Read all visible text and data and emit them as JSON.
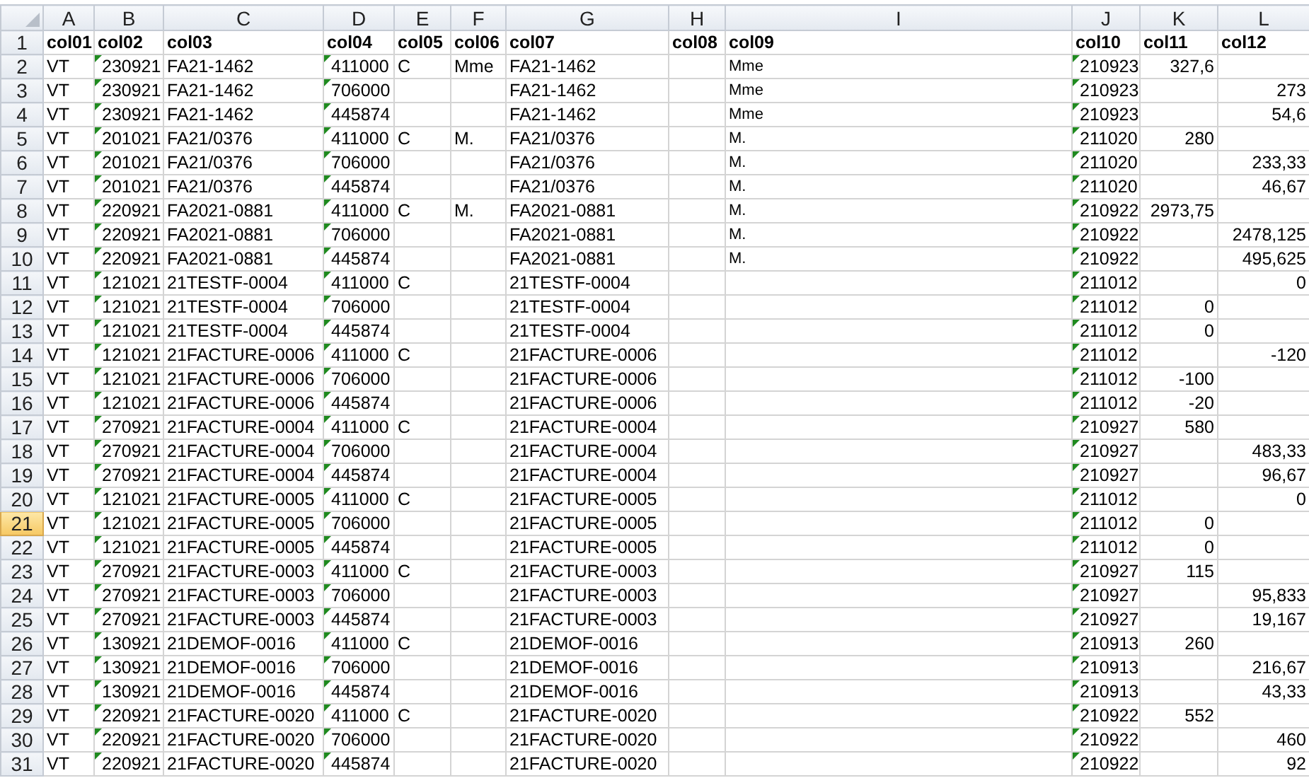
{
  "columns": [
    {
      "letter": "A",
      "kind": "text"
    },
    {
      "letter": "B",
      "kind": "flagged"
    },
    {
      "letter": "C",
      "kind": "text"
    },
    {
      "letter": "D",
      "kind": "flagged"
    },
    {
      "letter": "E",
      "kind": "text"
    },
    {
      "letter": "F",
      "kind": "text"
    },
    {
      "letter": "G",
      "kind": "text"
    },
    {
      "letter": "H",
      "kind": "text"
    },
    {
      "letter": "I",
      "kind": "small"
    },
    {
      "letter": "J",
      "kind": "flagged"
    },
    {
      "letter": "K",
      "kind": "number"
    },
    {
      "letter": "L",
      "kind": "number"
    }
  ],
  "header_row": {
    "number": "1",
    "selected": false,
    "cells": [
      "col01",
      "col02",
      "col03",
      "col04",
      "col05",
      "col06",
      "col07",
      "col08",
      "col09",
      "col10",
      "col11",
      "col12"
    ]
  },
  "rows": [
    {
      "number": "2",
      "selected": false,
      "cells": [
        "VT",
        "230921",
        "FA21-1462",
        "411000",
        "C",
        "Mme",
        "FA21-1462",
        null,
        "Mme",
        "210923",
        "327,6",
        null
      ]
    },
    {
      "number": "3",
      "selected": false,
      "cells": [
        "VT",
        "230921",
        "FA21-1462",
        "706000",
        null,
        null,
        "FA21-1462",
        null,
        "Mme",
        "210923",
        null,
        "273"
      ]
    },
    {
      "number": "4",
      "selected": false,
      "cells": [
        "VT",
        "230921",
        "FA21-1462",
        "445874",
        null,
        null,
        "FA21-1462",
        null,
        "Mme",
        "210923",
        null,
        "54,6"
      ]
    },
    {
      "number": "5",
      "selected": false,
      "cells": [
        "VT",
        "201021",
        "FA21/0376",
        "411000",
        "C",
        "M.",
        "FA21/0376",
        null,
        "M.",
        "211020",
        "280",
        null
      ]
    },
    {
      "number": "6",
      "selected": false,
      "cells": [
        "VT",
        "201021",
        "FA21/0376",
        "706000",
        null,
        null,
        "FA21/0376",
        null,
        "M.",
        "211020",
        null,
        "233,33"
      ]
    },
    {
      "number": "7",
      "selected": false,
      "cells": [
        "VT",
        "201021",
        "FA21/0376",
        "445874",
        null,
        null,
        "FA21/0376",
        null,
        "M.",
        "211020",
        null,
        "46,67"
      ]
    },
    {
      "number": "8",
      "selected": false,
      "cells": [
        "VT",
        "220921",
        "FA2021-0881",
        "411000",
        "C",
        "M.",
        "FA2021-0881",
        null,
        "M.",
        "210922",
        "2973,75",
        null
      ]
    },
    {
      "number": "9",
      "selected": false,
      "cells": [
        "VT",
        "220921",
        "FA2021-0881",
        "706000",
        null,
        null,
        "FA2021-0881",
        null,
        "M.",
        "210922",
        null,
        "2478,125"
      ]
    },
    {
      "number": "10",
      "selected": false,
      "cells": [
        "VT",
        "220921",
        "FA2021-0881",
        "445874",
        null,
        null,
        "FA2021-0881",
        null,
        "M.",
        "210922",
        null,
        "495,625"
      ]
    },
    {
      "number": "11",
      "selected": false,
      "cells": [
        "VT",
        "121021",
        "21TESTF-0004",
        "411000",
        "C",
        null,
        "21TESTF-0004",
        null,
        null,
        "211012",
        null,
        "0"
      ]
    },
    {
      "number": "12",
      "selected": false,
      "cells": [
        "VT",
        "121021",
        "21TESTF-0004",
        "706000",
        null,
        null,
        "21TESTF-0004",
        null,
        null,
        "211012",
        "0",
        null
      ]
    },
    {
      "number": "13",
      "selected": false,
      "cells": [
        "VT",
        "121021",
        "21TESTF-0004",
        "445874",
        null,
        null,
        "21TESTF-0004",
        null,
        null,
        "211012",
        "0",
        null
      ]
    },
    {
      "number": "14",
      "selected": false,
      "cells": [
        "VT",
        "121021",
        "21FACTURE-0006",
        "411000",
        "C",
        null,
        "21FACTURE-0006",
        null,
        null,
        "211012",
        null,
        "-120"
      ]
    },
    {
      "number": "15",
      "selected": false,
      "cells": [
        "VT",
        "121021",
        "21FACTURE-0006",
        "706000",
        null,
        null,
        "21FACTURE-0006",
        null,
        null,
        "211012",
        "-100",
        null
      ]
    },
    {
      "number": "16",
      "selected": false,
      "cells": [
        "VT",
        "121021",
        "21FACTURE-0006",
        "445874",
        null,
        null,
        "21FACTURE-0006",
        null,
        null,
        "211012",
        "-20",
        null
      ]
    },
    {
      "number": "17",
      "selected": false,
      "cells": [
        "VT",
        "270921",
        "21FACTURE-0004",
        "411000",
        "C",
        null,
        "21FACTURE-0004",
        null,
        null,
        "210927",
        "580",
        null
      ]
    },
    {
      "number": "18",
      "selected": false,
      "cells": [
        "VT",
        "270921",
        "21FACTURE-0004",
        "706000",
        null,
        null,
        "21FACTURE-0004",
        null,
        null,
        "210927",
        null,
        "483,33"
      ]
    },
    {
      "number": "19",
      "selected": false,
      "cells": [
        "VT",
        "270921",
        "21FACTURE-0004",
        "445874",
        null,
        null,
        "21FACTURE-0004",
        null,
        null,
        "210927",
        null,
        "96,67"
      ]
    },
    {
      "number": "20",
      "selected": false,
      "cells": [
        "VT",
        "121021",
        "21FACTURE-0005",
        "411000",
        "C",
        null,
        "21FACTURE-0005",
        null,
        null,
        "211012",
        null,
        "0"
      ]
    },
    {
      "number": "21",
      "selected": true,
      "cells": [
        "VT",
        "121021",
        "21FACTURE-0005",
        "706000",
        null,
        null,
        "21FACTURE-0005",
        null,
        null,
        "211012",
        "0",
        null
      ]
    },
    {
      "number": "22",
      "selected": false,
      "cells": [
        "VT",
        "121021",
        "21FACTURE-0005",
        "445874",
        null,
        null,
        "21FACTURE-0005",
        null,
        null,
        "211012",
        "0",
        null
      ]
    },
    {
      "number": "23",
      "selected": false,
      "cells": [
        "VT",
        "270921",
        "21FACTURE-0003",
        "411000",
        "C",
        null,
        "21FACTURE-0003",
        null,
        null,
        "210927",
        "115",
        null
      ]
    },
    {
      "number": "24",
      "selected": false,
      "cells": [
        "VT",
        "270921",
        "21FACTURE-0003",
        "706000",
        null,
        null,
        "21FACTURE-0003",
        null,
        null,
        "210927",
        null,
        "95,833"
      ]
    },
    {
      "number": "25",
      "selected": false,
      "cells": [
        "VT",
        "270921",
        "21FACTURE-0003",
        "445874",
        null,
        null,
        "21FACTURE-0003",
        null,
        null,
        "210927",
        null,
        "19,167"
      ]
    },
    {
      "number": "26",
      "selected": false,
      "cells": [
        "VT",
        "130921",
        "21DEMOF-0016",
        "411000",
        "C",
        null,
        "21DEMOF-0016",
        null,
        null,
        "210913",
        "260",
        null
      ]
    },
    {
      "number": "27",
      "selected": false,
      "cells": [
        "VT",
        "130921",
        "21DEMOF-0016",
        "706000",
        null,
        null,
        "21DEMOF-0016",
        null,
        null,
        "210913",
        null,
        "216,67"
      ]
    },
    {
      "number": "28",
      "selected": false,
      "cells": [
        "VT",
        "130921",
        "21DEMOF-0016",
        "445874",
        null,
        null,
        "21DEMOF-0016",
        null,
        null,
        "210913",
        null,
        "43,33"
      ]
    },
    {
      "number": "29",
      "selected": false,
      "cells": [
        "VT",
        "220921",
        "21FACTURE-0020",
        "411000",
        "C",
        null,
        "21FACTURE-0020",
        null,
        null,
        "210922",
        "552",
        null
      ]
    },
    {
      "number": "30",
      "selected": false,
      "cells": [
        "VT",
        "220921",
        "21FACTURE-0020",
        "706000",
        null,
        null,
        "21FACTURE-0020",
        null,
        null,
        "210922",
        null,
        "460"
      ]
    },
    {
      "number": "31",
      "selected": false,
      "cells": [
        "VT",
        "220921",
        "21FACTURE-0020",
        "445874",
        null,
        null,
        "21FACTURE-0020",
        null,
        null,
        "210922",
        null,
        "92"
      ]
    }
  ]
}
